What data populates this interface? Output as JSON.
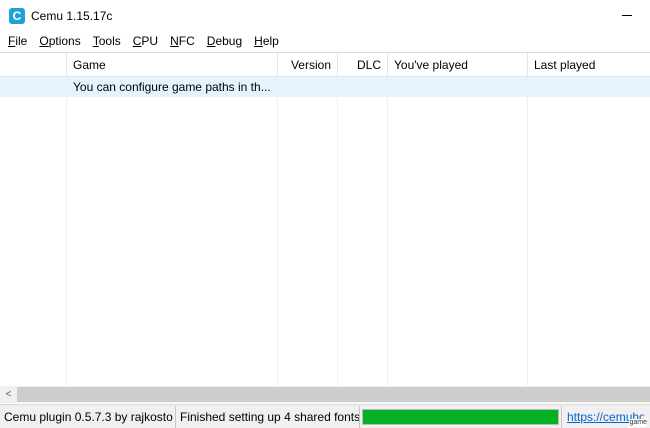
{
  "window": {
    "title": "Cemu 1.15.17c",
    "icon": "cemu-app-icon",
    "icon_letter": "C"
  },
  "menu": [
    {
      "accel": "F",
      "rest": "ile"
    },
    {
      "accel": "O",
      "rest": "ptions"
    },
    {
      "accel": "T",
      "rest": "ools"
    },
    {
      "accel": "C",
      "rest": "PU"
    },
    {
      "accel": "N",
      "rest": "FC"
    },
    {
      "accel": "D",
      "rest": "ebug"
    },
    {
      "accel": "H",
      "rest": "elp"
    }
  ],
  "table": {
    "columns": [
      "",
      "Game",
      "Version",
      "DLC",
      "You've played",
      "Last played"
    ],
    "rows": [
      {
        "game": "You can configure game paths in th...",
        "version": "",
        "dlc": "",
        "played": "",
        "last_played": ""
      }
    ],
    "selected_row_color": "#e5f3ff"
  },
  "scrollbar": {
    "left_arrow": "<"
  },
  "status": {
    "plugin": "Cemu plugin 0.5.7.3 by rajkosto",
    "message": "Finished setting up 4 shared fonts",
    "progress": 1.0,
    "progress_color": "#06b025",
    "link": "https://cemuhook",
    "grip_label": "game"
  }
}
